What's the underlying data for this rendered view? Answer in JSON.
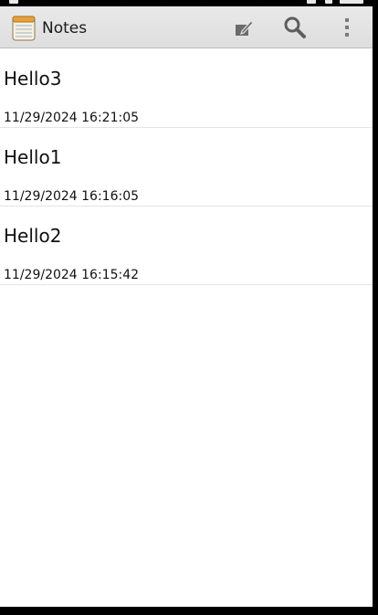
{
  "app": {
    "title": "Notes",
    "icon": "notepad-icon"
  },
  "action_bar": {
    "actions": [
      {
        "name": "new-note",
        "icon": "compose-icon"
      },
      {
        "name": "search",
        "icon": "search-icon"
      },
      {
        "name": "more-options",
        "icon": "overflow-menu-icon"
      }
    ]
  },
  "notes": [
    {
      "title": "Hello3",
      "date": "11/29/2024 16:21:05"
    },
    {
      "title": "Hello1",
      "date": "11/29/2024 16:16:05"
    },
    {
      "title": "Hello2",
      "date": "11/29/2024 16:15:42"
    }
  ],
  "colors": {
    "action_bar_bg": "#e4e4e4",
    "background": "#ffffff",
    "text": "#111111",
    "divider": "#e4e4e4"
  }
}
